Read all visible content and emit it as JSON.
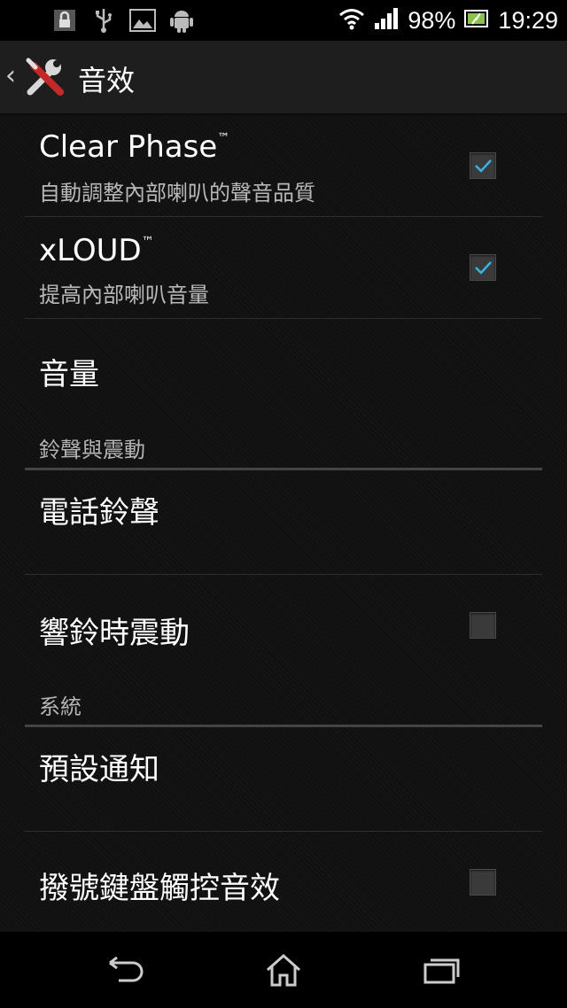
{
  "status_bar": {
    "battery_percent": "98%",
    "time": "19:29",
    "left_icons": [
      "lock-icon",
      "usb-icon",
      "image-icon",
      "android-icon"
    ],
    "right_icons": [
      "wifi-icon",
      "signal-icon",
      "battery-icon"
    ]
  },
  "action_bar": {
    "title": "音效",
    "icon": "tools-icon",
    "back_icon": "chevron-left-icon"
  },
  "settings": {
    "clear_phase": {
      "title": "Clear Phase",
      "tm": "™",
      "subtitle": "自動調整內部喇叭的聲音品質",
      "checked": true
    },
    "xloud": {
      "title": "xLOUD",
      "tm": "™",
      "subtitle": "提高內部喇叭音量",
      "checked": true
    },
    "volume": {
      "title": "音量"
    },
    "section_ringtone": {
      "label": "鈴聲與震動"
    },
    "phone_ringtone": {
      "title": "電話鈴聲"
    },
    "vibrate_on_ring": {
      "title": "響鈴時震動",
      "checked": false
    },
    "section_system": {
      "label": "系統"
    },
    "default_notification": {
      "title": "預設通知"
    },
    "dialpad_touch_tones": {
      "title": "撥號鍵盤觸控音效",
      "checked": false
    }
  },
  "nav_bar": {
    "buttons": [
      "back-icon",
      "home-icon",
      "recent-apps-icon"
    ]
  },
  "colors": {
    "accent_check": "#33b5e5",
    "background": "#111111",
    "divider": "#2e2e2e"
  }
}
